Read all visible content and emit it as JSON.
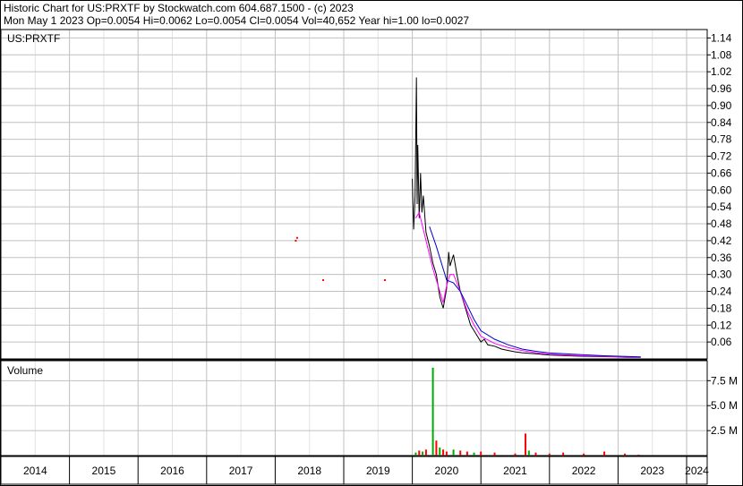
{
  "header": {
    "line1": "Historic Chart for US:PRXTF by Stockwatch.com 604.687.1500 - (c) 2023",
    "line2": "Mon May  1 2023   Op=0.0054  Hi=0.0062  Lo=0.0054  Cl=0.0054  Vol=40,652  Year hi=1.00  lo=0.0027"
  },
  "colors": {
    "price": "#000000",
    "ma_short": "#ff00ff",
    "ma_long": "#0000cc",
    "volume_up": "#00aa00",
    "volume_down": "#ff0000",
    "grid": "#c0c0c0",
    "dot": "#ff0000"
  },
  "chart_data": [
    {
      "type": "line",
      "title": "US:PRXTF",
      "yticks": [
        "1.14",
        "1.08",
        "1.02",
        "0.96",
        "0.90",
        "0.84",
        "0.78",
        "0.72",
        "0.66",
        "0.60",
        "0.54",
        "0.48",
        "0.42",
        "0.36",
        "0.30",
        "0.24",
        "0.18",
        "0.12",
        "0.06"
      ],
      "ylim": [
        0,
        1.17
      ],
      "xlim": [
        2014.0,
        2024.3
      ],
      "isolated_points": [
        {
          "x": 2018.3,
          "y": 0.42
        },
        {
          "x": 2018.32,
          "y": 0.43
        },
        {
          "x": 2018.7,
          "y": 0.28
        },
        {
          "x": 2019.6,
          "y": 0.28
        }
      ],
      "series": [
        {
          "role": "price",
          "x": [
            2020.0,
            2020.02,
            2020.04,
            2020.06,
            2020.07,
            2020.08,
            2020.1,
            2020.12,
            2020.14,
            2020.16,
            2020.2,
            2020.25,
            2020.3,
            2020.35,
            2020.4,
            2020.45,
            2020.5,
            2020.53,
            2020.55,
            2020.6,
            2020.65,
            2020.7,
            2020.75,
            2020.8,
            2020.85,
            2020.9,
            2020.95,
            2021.0,
            2021.05,
            2021.1,
            2021.2,
            2021.3,
            2021.4,
            2021.5,
            2021.6,
            2021.7,
            2021.8,
            2021.9,
            2022.0,
            2022.2,
            2022.4,
            2022.6,
            2022.8,
            2023.0,
            2023.1,
            2023.2,
            2023.33
          ],
          "y": [
            0.64,
            0.46,
            0.58,
            1.0,
            0.55,
            0.76,
            0.5,
            0.66,
            0.52,
            0.58,
            0.45,
            0.4,
            0.34,
            0.3,
            0.22,
            0.18,
            0.25,
            0.38,
            0.33,
            0.37,
            0.3,
            0.24,
            0.2,
            0.16,
            0.12,
            0.1,
            0.08,
            0.06,
            0.07,
            0.05,
            0.045,
            0.035,
            0.03,
            0.025,
            0.022,
            0.02,
            0.018,
            0.016,
            0.014,
            0.012,
            0.01,
            0.009,
            0.008,
            0.007,
            0.006,
            0.0055,
            0.0054
          ]
        },
        {
          "role": "ma_short",
          "x": [
            2020.05,
            2020.1,
            2020.2,
            2020.3,
            2020.4,
            2020.45,
            2020.5,
            2020.55,
            2020.6,
            2020.7,
            2020.8,
            2020.9,
            2021.0,
            2021.2,
            2021.4,
            2021.6,
            2021.8,
            2022.0,
            2022.4,
            2022.8,
            2023.33
          ],
          "y": [
            0.5,
            0.52,
            0.42,
            0.32,
            0.24,
            0.2,
            0.26,
            0.3,
            0.3,
            0.24,
            0.17,
            0.12,
            0.08,
            0.055,
            0.04,
            0.03,
            0.022,
            0.017,
            0.012,
            0.009,
            0.006
          ]
        },
        {
          "role": "ma_long",
          "x": [
            2020.25,
            2020.35,
            2020.5,
            2020.6,
            2020.7,
            2020.8,
            2020.9,
            2021.0,
            2021.2,
            2021.4,
            2021.6,
            2021.8,
            2022.0,
            2022.4,
            2022.8,
            2023.33
          ],
          "y": [
            0.47,
            0.4,
            0.28,
            0.27,
            0.24,
            0.19,
            0.14,
            0.1,
            0.07,
            0.05,
            0.035,
            0.027,
            0.021,
            0.016,
            0.011,
            0.007
          ]
        }
      ]
    },
    {
      "type": "bar",
      "title": "Volume",
      "yticks": [
        "7.5 M",
        "5.0 M",
        "2.5 M"
      ],
      "ylim": [
        0,
        9.5
      ],
      "x": [
        2020.05,
        2020.1,
        2020.15,
        2020.2,
        2020.3,
        2020.35,
        2020.4,
        2020.45,
        2020.5,
        2020.6,
        2020.7,
        2020.8,
        2020.9,
        2021.0,
        2021.2,
        2021.5,
        2021.65,
        2021.7,
        2021.8,
        2022.0,
        2022.2,
        2022.5,
        2022.8,
        2023.1,
        2023.3
      ],
      "values": [
        0.3,
        0.5,
        0.4,
        0.6,
        8.8,
        1.5,
        0.8,
        0.6,
        0.4,
        0.6,
        0.5,
        0.4,
        0.3,
        0.4,
        0.3,
        0.2,
        2.2,
        0.5,
        0.3,
        0.2,
        0.3,
        0.2,
        0.4,
        0.2,
        0.1
      ],
      "colors": [
        "up",
        "down",
        "up",
        "down",
        "up",
        "down",
        "up",
        "down",
        "down",
        "up",
        "down",
        "down",
        "up",
        "down",
        "down",
        "down",
        "down",
        "up",
        "down",
        "down",
        "down",
        "down",
        "down",
        "down",
        "down"
      ]
    }
  ],
  "x_axis": {
    "tick_labels": [
      "2014",
      "2015",
      "2016",
      "2017",
      "2018",
      "2019",
      "2020",
      "2021",
      "2022",
      "2023",
      "2024"
    ]
  }
}
